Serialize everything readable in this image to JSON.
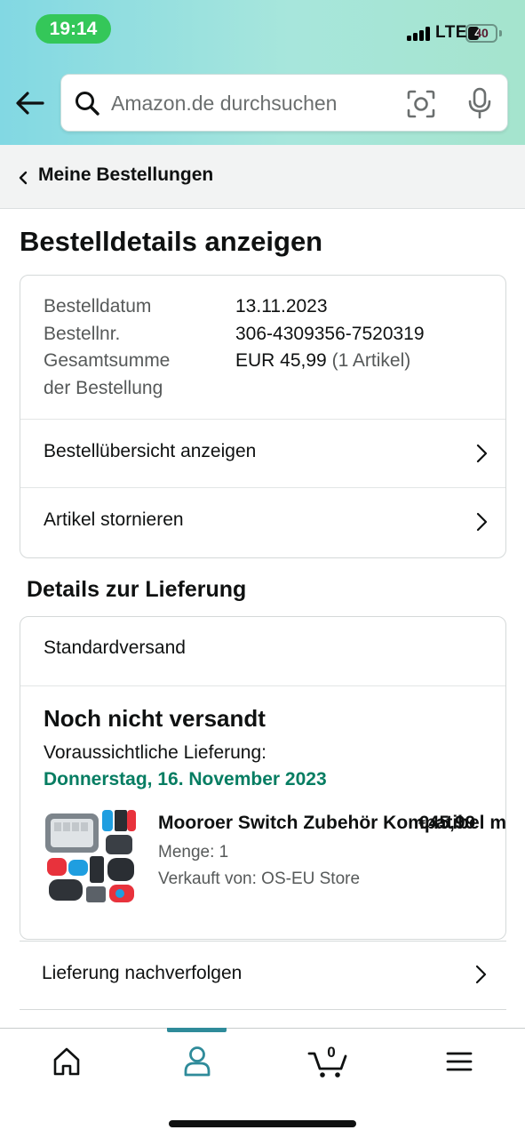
{
  "status_bar": {
    "time": "19:14",
    "network": "LTE",
    "battery_level": "40"
  },
  "search": {
    "placeholder": "Amazon.de durchsuchen"
  },
  "breadcrumb": {
    "label": "Meine Bestellungen"
  },
  "page_title": "Bestelldetails anzeigen",
  "order_info": {
    "date_label": "Bestelldatum",
    "date_value": "13.11.2023",
    "number_label": "Bestellnr.",
    "number_value": "306-4309356-7520319",
    "total_label_line1": "Gesamtsumme",
    "total_label_line2": "der Bestellung",
    "total_value": "EUR 45,99",
    "total_items": "(1 Artikel)"
  },
  "order_actions": {
    "overview_label": "Bestellübersicht anzeigen",
    "cancel_label": "Artikel stornieren"
  },
  "delivery": {
    "section_title": "Details zur Lieferung",
    "shipping_method": "Standardversand",
    "status": "Noch nicht versandt",
    "eta_label": "Voraussichtliche Lieferung:",
    "eta_date": "Donnerstag, 16. November 2023",
    "accent_color": "#067d62",
    "product": {
      "title": "Mooroer Switch Zubehör Kompatibel m",
      "price": "€45,99",
      "quantity": "Menge: 1",
      "seller": "Verkauft von: OS-EU Store"
    },
    "track_label": "Lieferung nachverfolgen"
  },
  "bottom_nav": {
    "items": [
      "home-icon",
      "account-icon",
      "cart-icon",
      "menu-icon"
    ],
    "active": "account-icon",
    "cart_count": "0",
    "active_color": "#2f8b9a"
  }
}
